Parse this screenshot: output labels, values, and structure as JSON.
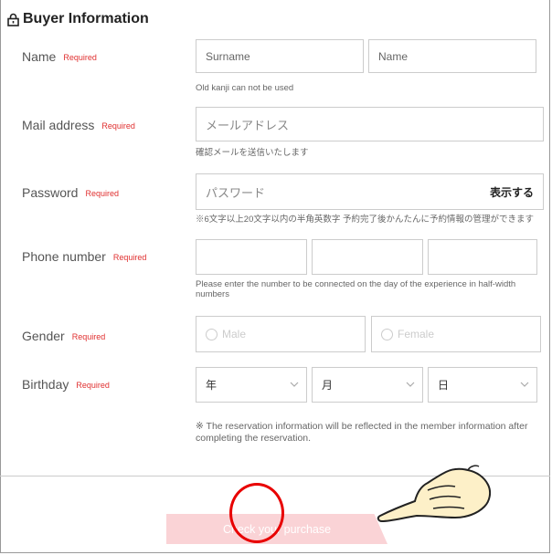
{
  "header": {
    "title": "Buyer Information"
  },
  "form": {
    "required_label": "Required",
    "name": {
      "label": "Name",
      "surname_placeholder": "Surname",
      "name_placeholder": "Name",
      "hint": "Old kanji can not be used"
    },
    "mail": {
      "label": "Mail address",
      "placeholder": "メールアドレス",
      "hint": "確認メールを送信いたします"
    },
    "password": {
      "label": "Password",
      "placeholder": "パスワード",
      "toggle": "表示する",
      "hint": "※6文字以上20文字以内の半角英数字 予約完了後かんたんに予約情報の管理ができます"
    },
    "phone": {
      "label": "Phone number",
      "hint": "Please enter the number to be connected on the day of the experience in half-width numbers"
    },
    "gender": {
      "label": "Gender",
      "male": "Male",
      "female": "Female"
    },
    "birthday": {
      "label": "Birthday",
      "year": "年",
      "month": "月",
      "day": "日"
    },
    "note": "※ The reservation information will be reflected in the member information after completing the reservation."
  },
  "submit": {
    "label": "Check your purchase"
  },
  "icons": [
    "lock-icon",
    "chevron-down-icon",
    "pointing-hand-icon"
  ],
  "colors": {
    "required": "#e03030",
    "submit_bg": "#fad3d6",
    "annotation": "#e80000"
  }
}
